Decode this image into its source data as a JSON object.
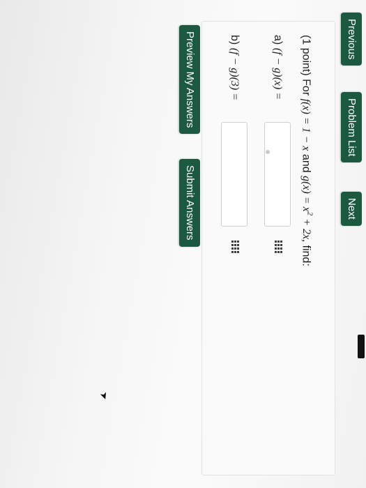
{
  "nav": {
    "previous_label": "Previous",
    "problem_list_label": "Problem List",
    "next_label": "Next"
  },
  "problem": {
    "points": "(1 point)",
    "for_word": "For",
    "f_def": "f(x) = 1 − x",
    "and_word": "and",
    "g_def_base": "g(x) = x",
    "g_def_exp": "2",
    "g_def_tail": "+ 2x,",
    "find_word": "find:",
    "part_a_label": "a)",
    "part_a_expr": "(f − g)(x) =",
    "part_b_label": "b)",
    "part_b_expr": "(f − g)(3) =",
    "answer_a_value": "",
    "answer_b_value": ""
  },
  "actions": {
    "preview_label": "Preview My Answers",
    "submit_label": "Submit Answers"
  },
  "colors": {
    "button_bg": "#1b5a41",
    "button_text": "#ffffff",
    "panel_bg": "#fafafa"
  },
  "icons": {
    "equation_editor": "grid-icon",
    "mouse_cursor": "cursor-arrow-icon"
  }
}
